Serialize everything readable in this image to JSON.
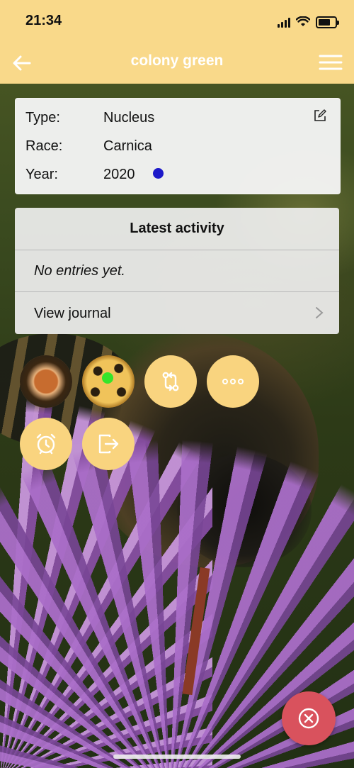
{
  "status_bar": {
    "time": "21:34"
  },
  "header": {
    "title": "colony green"
  },
  "colony_info": {
    "rows": [
      {
        "label": "Type:",
        "value": "Nucleus"
      },
      {
        "label": "Race:",
        "value": "Carnica"
      },
      {
        "label": "Year:",
        "value": "2020"
      }
    ],
    "year_marker_color": "#1d19c9"
  },
  "activity": {
    "title": "Latest activity",
    "empty_text": "No entries yet.",
    "journal_label": "View journal"
  },
  "actions": [
    {
      "icon": "mite-photo"
    },
    {
      "icon": "queen-bee-photo",
      "marker_color": "#34e52a"
    },
    {
      "icon": "swap-arrows-icon"
    },
    {
      "icon": "more-dots-icon"
    },
    {
      "icon": "alarm-clock-icon"
    },
    {
      "icon": "exit-icon"
    }
  ],
  "colors": {
    "header_bg": "#f9d98a",
    "action_button_bg": "#f9d47f",
    "close_fab_bg": "#d9525d"
  }
}
